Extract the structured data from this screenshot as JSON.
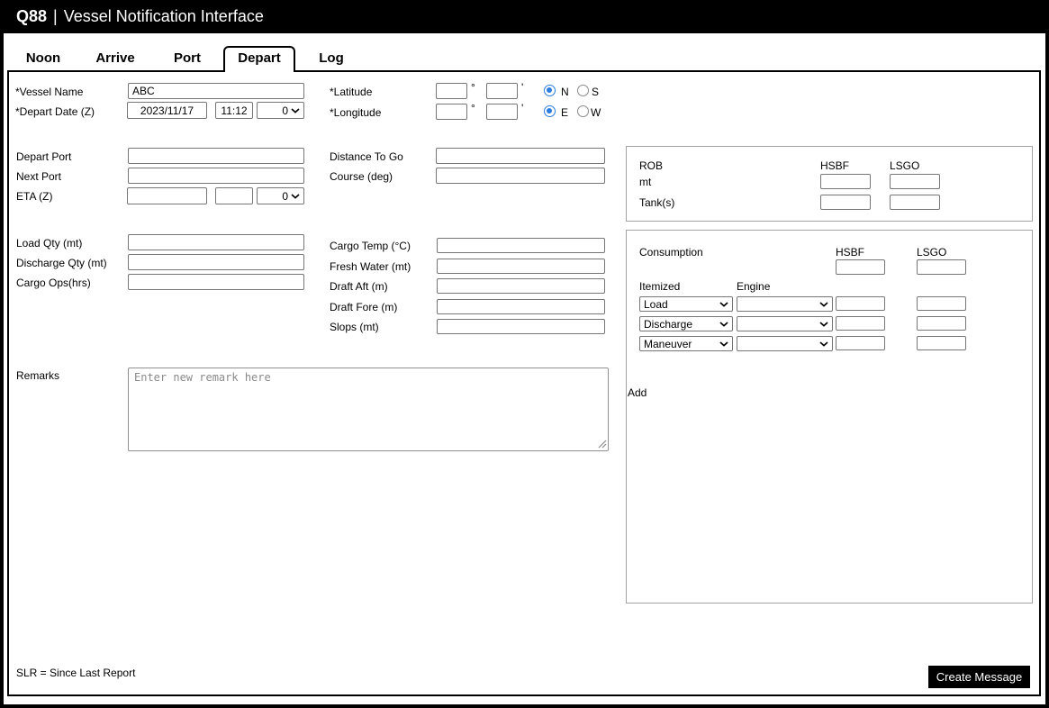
{
  "window": {
    "brand": "Q88",
    "separator": "|",
    "title": "Vessel Notification Interface"
  },
  "tabs": [
    {
      "label": "Noon",
      "active": false
    },
    {
      "label": "Arrive",
      "active": false
    },
    {
      "label": "Port",
      "active": false
    },
    {
      "label": "Depart",
      "active": true
    },
    {
      "label": "Log",
      "active": false
    }
  ],
  "form": {
    "vessel_name": {
      "label": "*Vessel Name",
      "value": "ABC"
    },
    "depart_date": {
      "label": "*Depart Date (Z)",
      "date": "2023/11/17",
      "time": "11:12",
      "tz": "0"
    },
    "latitude": {
      "label": "*Latitude",
      "deg": "",
      "min": "",
      "deg_unit": "°",
      "min_unit": "'",
      "north": "N",
      "south": "S",
      "selected": "N"
    },
    "longitude": {
      "label": "*Longitude",
      "deg": "",
      "min": "",
      "deg_unit": "°",
      "min_unit": "'",
      "east": "E",
      "west": "W",
      "selected": "E"
    },
    "depart_port": {
      "label": "Depart Port",
      "value": ""
    },
    "next_port": {
      "label": "Next Port",
      "value": ""
    },
    "eta": {
      "label": "ETA (Z)",
      "date": "",
      "time": "",
      "tz": "0"
    },
    "distance_to_go": {
      "label": "Distance To Go",
      "value": ""
    },
    "course": {
      "label": "Course (deg)",
      "value": ""
    },
    "load_qty": {
      "label": "Load Qty (mt)",
      "value": ""
    },
    "discharge_qty": {
      "label": "Discharge Qty (mt)",
      "value": ""
    },
    "cargo_ops": {
      "label": "Cargo Ops(hrs)",
      "value": ""
    },
    "cargo_temp": {
      "label": "Cargo Temp (°C)",
      "value": ""
    },
    "fresh_water": {
      "label": "Fresh Water (mt)",
      "value": ""
    },
    "draft_aft": {
      "label": "Draft Aft (m)",
      "value": ""
    },
    "draft_fore": {
      "label": "Draft Fore (m)",
      "value": ""
    },
    "slops": {
      "label": "Slops (mt)",
      "value": ""
    },
    "remarks": {
      "label": "Remarks",
      "placeholder": "Enter new remark here"
    }
  },
  "rob": {
    "title": "ROB",
    "col_hsbf": "HSBF",
    "col_lsgo": "LSGO",
    "row_mt": "mt",
    "row_tanks": "Tank(s)",
    "mt_hsbf": "",
    "mt_lsgo": "",
    "tanks_hsbf": "",
    "tanks_lsgo": ""
  },
  "consumption": {
    "title": "Consumption",
    "col_hsbf": "HSBF",
    "col_lsgo": "LSGO",
    "total_hsbf": "",
    "total_lsgo": "",
    "itemized_header": "Itemized",
    "engine_header": "Engine",
    "rows": [
      {
        "itemized": "Load",
        "engine": "",
        "hsbf": "",
        "lsgo": ""
      },
      {
        "itemized": "Discharge",
        "engine": "",
        "hsbf": "",
        "lsgo": ""
      },
      {
        "itemized": "Maneuver",
        "engine": "",
        "hsbf": "",
        "lsgo": ""
      }
    ],
    "add": "Add"
  },
  "footer": {
    "note": "SLR = Since Last Report",
    "create_button": "Create Message"
  },
  "colors": {
    "header_bg": "#000000",
    "button_bg": "#000000",
    "radio_accent": "#2a7ce0",
    "panel_border": "#a3a3a3"
  }
}
